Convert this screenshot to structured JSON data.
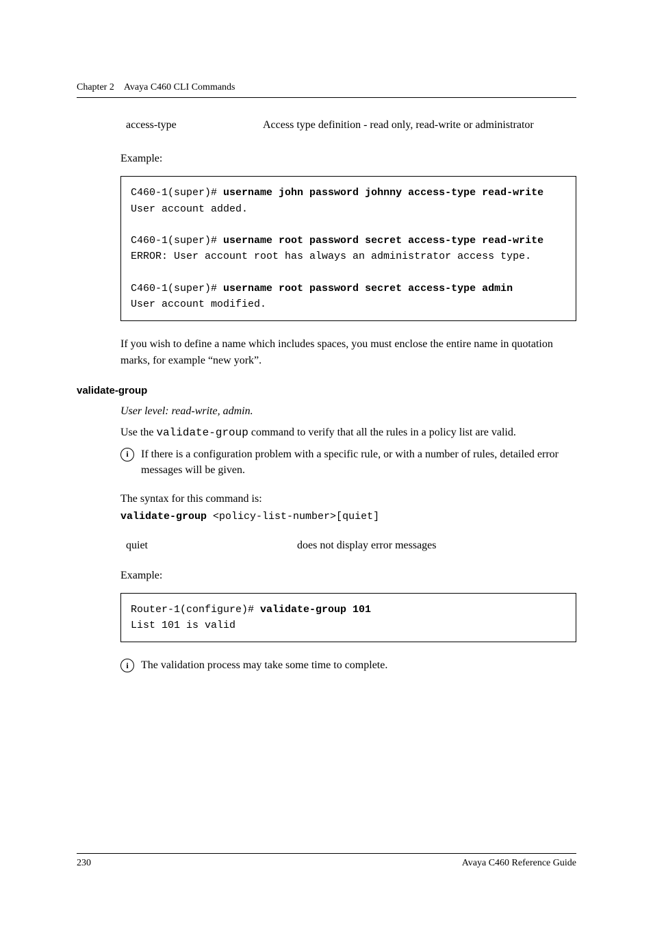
{
  "header": {
    "chapter": "Chapter 2",
    "title": "Avaya C460 CLI Commands"
  },
  "param1": {
    "name": "access-type",
    "desc": "Access type definition - read only, read-write or administrator"
  },
  "example_label": "Example:",
  "codebox1": {
    "l1a": "C460-1(super)# ",
    "l1b": "username john password johnny access-type read-write",
    "l2": "User account added.",
    "l3a": "C460-1(super)# ",
    "l3b": "username root password secret access-type read-write",
    "l4": "ERROR: User account root has always an administrator access type.",
    "l5a": "C460-1(super)# ",
    "l5b": "username root password secret access-type admin",
    "l6": "User account modified."
  },
  "note1": "If you wish to define a name which includes spaces, you must enclose the entire name in quotation marks, for example “new york”.",
  "section2": {
    "heading": "validate-group",
    "userlevel": "User level: read-write, admin.",
    "desc_a": "Use the ",
    "desc_cmd": "validate-group",
    "desc_b": " command to verify that all the rules in a policy list are valid.",
    "info1": "If there is a configuration problem with a specific rule, or with a number of rules, detailed error messages will be given.",
    "syntax_label": "The syntax for this command is:",
    "syntax_bold": "validate-group",
    "syntax_rest": " <policy-list-number>[quiet]",
    "param": {
      "name": "quiet",
      "desc": "does not display error messages"
    },
    "codebox": {
      "l1a": "Router-1(configure)# ",
      "l1b": "validate-group 101",
      "l2": "List 101 is valid"
    },
    "info2": "The validation process may take some time to complete."
  },
  "footer": {
    "page": "230",
    "title": "Avaya C460 Reference Guide"
  },
  "icon_glyph": "i"
}
